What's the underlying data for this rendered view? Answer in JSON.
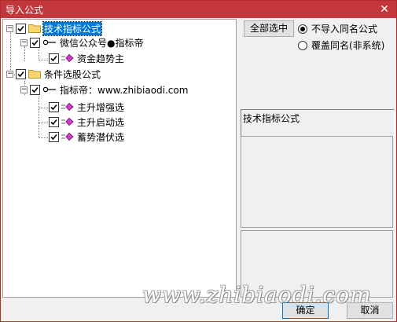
{
  "window": {
    "title": "导入公式",
    "close_glyph": "✕"
  },
  "tree": {
    "root1": {
      "label": "技术指标公式",
      "expander": "−"
    },
    "group1": {
      "label": "微信公众号●指标帝",
      "expander": "−"
    },
    "item1": {
      "label": "资金趋势主"
    },
    "root2": {
      "label": "条件选股公式",
      "expander": "−"
    },
    "group2": {
      "label": "指标帝：www.zhibiaodi.com",
      "expander": "−"
    },
    "item2": {
      "label": "主升增强选"
    },
    "item3": {
      "label": "主升启动选"
    },
    "item4": {
      "label": "蓄势潜伏选"
    }
  },
  "right": {
    "select_all_label": "全部选中",
    "radio_no_import": "不导入同名公式",
    "radio_overwrite": "覆盖同名(非系统)",
    "info_title": "技术指标公式"
  },
  "footer": {
    "ok_label": "确定",
    "cancel_label": "取消"
  },
  "watermark": "www.zhibiaodi.com",
  "colors": {
    "titlebar": "#c3363b",
    "selection": "#0078d7",
    "leaf_icon": "#d63bd0",
    "folder": "#f5d76e"
  }
}
